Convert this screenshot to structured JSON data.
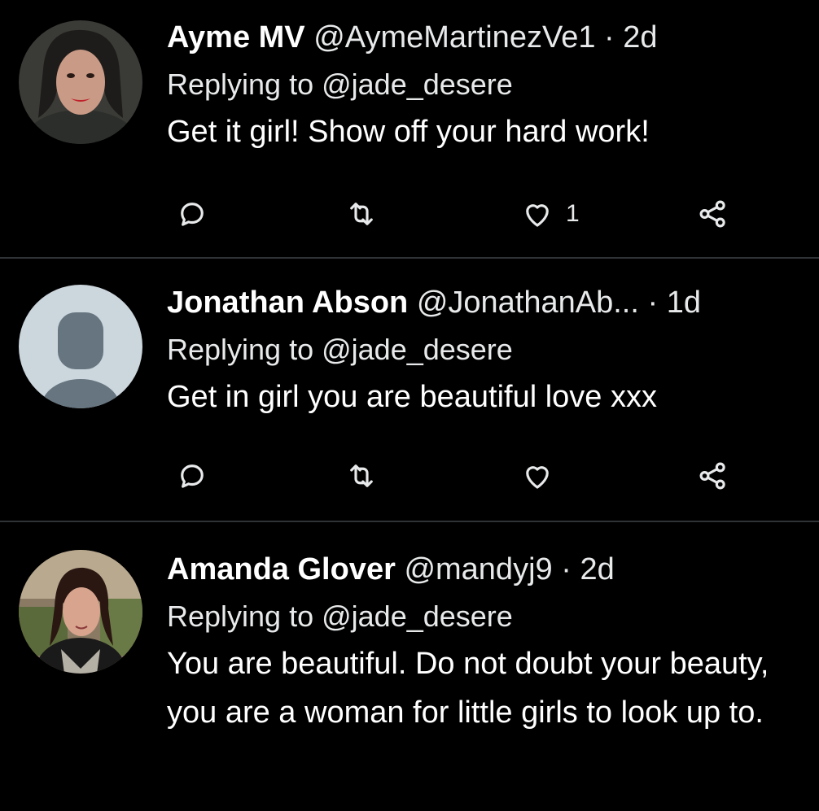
{
  "replies": [
    {
      "name": "Ayme MV",
      "handle": "@AymeMartinezVe1",
      "separator": "·",
      "time": "2d",
      "replying_to": "Replying to @jade_desere",
      "text": "Get it girl!  Show off your hard work!",
      "like_count": "1",
      "avatar": "photo-avatar"
    },
    {
      "name": "Jonathan Abson",
      "handle": "@JonathanAb...",
      "separator": "·",
      "time": "1d",
      "replying_to": "Replying to @jade_desere",
      "text": "Get in girl you are beautiful love xxx",
      "like_count": "",
      "avatar": "default-avatar"
    },
    {
      "name": "Amanda Glover",
      "handle": "@mandyj9",
      "separator": "·",
      "time": "2d",
      "replying_to": "Replying to @jade_desere",
      "text": "You are beautiful. Do not doubt your beauty, you are a woman for little girls to look up to.",
      "avatar": "photo-avatar"
    }
  ],
  "colors": {
    "background": "#000000",
    "text": "#e7e9ea",
    "divider": "#2f3336",
    "default_avatar_bg": "#ccd6dd",
    "default_avatar_fg": "#66757f"
  }
}
